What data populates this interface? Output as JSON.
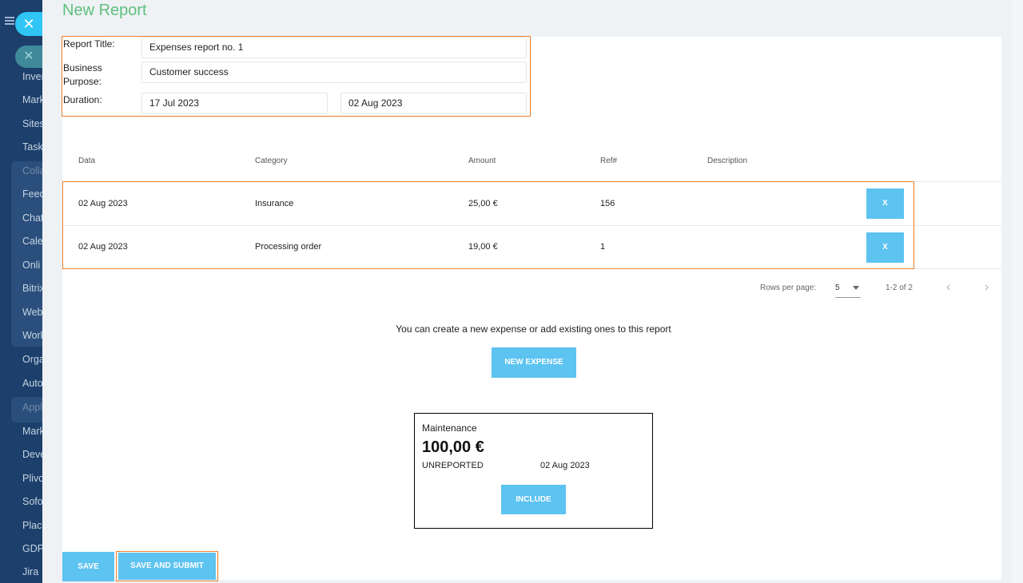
{
  "sidebar": {
    "items": [
      "Inver",
      "Mark",
      "Sites",
      "Task",
      "Colla",
      "Feed",
      "Chat",
      "Cale",
      "Onli",
      "Bitrix",
      "Web",
      "Work",
      "Orga",
      "Auto",
      "Appl",
      "Mark",
      "Deve",
      "Plivo",
      "Sofo",
      "Place",
      "GDP",
      "Jira"
    ]
  },
  "page": {
    "title": "New Report"
  },
  "form": {
    "title_label": "Report Title:",
    "title_value": "Expenses report no. 1",
    "purpose_label_1": "Business",
    "purpose_label_2": "Purpose:",
    "purpose_value": "Customer success",
    "duration_label": "Duration:",
    "duration_from": "17 Jul 2023",
    "duration_to": "02 Aug 2023"
  },
  "table": {
    "headers": [
      "Data",
      "Category",
      "Amount",
      "Ref#",
      "Description"
    ],
    "rows": [
      {
        "date": "02 Aug 2023",
        "category": "Insurance",
        "amount": "25,00 €",
        "ref": "156",
        "description": "",
        "remove_label": "X"
      },
      {
        "date": "02 Aug 2023",
        "category": "Processing order",
        "amount": "19,00 €",
        "ref": "1",
        "description": "",
        "remove_label": "X"
      }
    ]
  },
  "pagination": {
    "rows_per_page_label": "Rows per page:",
    "rows_per_page_value": "5",
    "range": "1-2 of 2",
    "prev_icon": "chevron-left-icon",
    "next_icon": "chevron-right-icon"
  },
  "info_text": "You can create a new expense or add existing ones to this report",
  "new_expense_label": "NEW EXPENSE",
  "expense_card": {
    "name": "Maintenance",
    "amount": "100,00 €",
    "status": "UNREPORTED",
    "date": "02 Aug 2023",
    "include_label": "INCLUDE"
  },
  "footer": {
    "save_label": "SAVE",
    "save_submit_label": "SAVE AND SUBMIT"
  },
  "colors": {
    "accent": "#5dc3f0",
    "highlight": "#f07f2c",
    "title_green": "#5fbf7f",
    "sidebar": "#1c3f6b"
  }
}
